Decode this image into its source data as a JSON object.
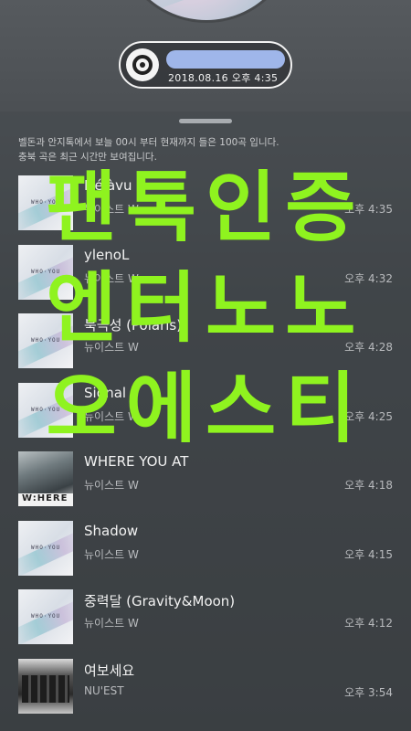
{
  "header": {
    "timestamp": "2018.08.16 오후 4:35"
  },
  "notice": {
    "line1": "벨돈과 안지톡에서 보늘 00시 부터 현재까지 들은 100곡 입니다.",
    "line2": "충북 곡은 최근 시간만 보여집니다."
  },
  "songs": [
    {
      "title": "Déjàvu",
      "artist": "뉴이스트 W",
      "time": "오후 4:35"
    },
    {
      "title": "ylenoL",
      "artist": "뉴이스트 W",
      "time": "오후 4:32"
    },
    {
      "title": "북극성 (Polaris)",
      "artist": "뉴이스트 W",
      "time": "오후 4:28"
    },
    {
      "title": "Signal",
      "artist": "뉴이스트 W",
      "time": "오후 4:25"
    },
    {
      "title": "WHERE YOU AT",
      "artist": "뉴이스트 W",
      "time": "오후 4:18"
    },
    {
      "title": "Shadow",
      "artist": "뉴이스트 W",
      "time": "오후 4:15"
    },
    {
      "title": "중력달 (Gravity&Moon)",
      "artist": "뉴이스트 W",
      "time": "오후 4:12"
    },
    {
      "title": "여보세요",
      "artist": "NU'EST",
      "time": "오후 3:54"
    }
  ],
  "overlay": {
    "line1": "팬톡인증",
    "line2": "엔터노노",
    "line3": "오에스티"
  },
  "colors": {
    "overlay_text": "#8ff31f",
    "pill_blur": "#9fb6ea"
  }
}
